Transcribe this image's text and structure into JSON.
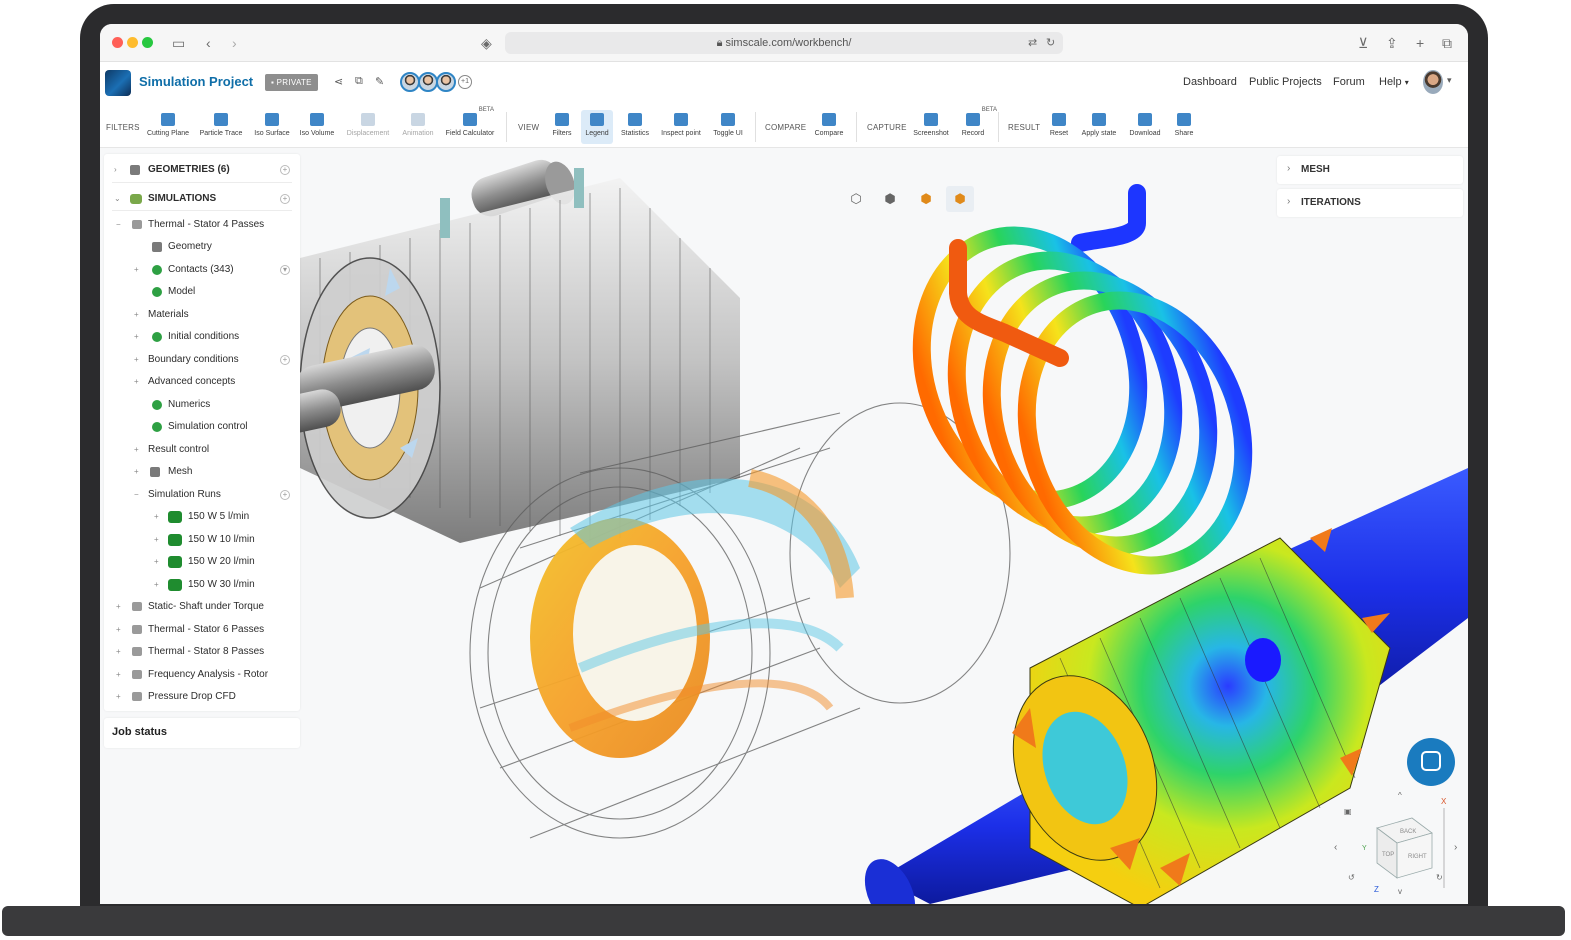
{
  "browser": {
    "url": "simscale.com/workbench/"
  },
  "header": {
    "project_title": "Simulation Project",
    "private_label": "PRIVATE",
    "more_collaborators": "+1",
    "nav": [
      "Dashboard",
      "Public Projects",
      "Forum",
      "Help"
    ]
  },
  "toolbar": {
    "groups": {
      "filters": "FILTERS",
      "view": "VIEW",
      "compare": "COMPARE",
      "capture": "CAPTURE",
      "result": "RESULT"
    },
    "beta": "BETA",
    "buttons": {
      "cutting_plane": "Cutting Plane",
      "particle_trace": "Particle Trace",
      "iso_surface": "Iso Surface",
      "iso_volume": "Iso Volume",
      "displacement": "Displacement",
      "animation": "Animation",
      "field_calculator": "Field Calculator",
      "filters": "Filters",
      "legend": "Legend",
      "statistics": "Statistics",
      "inspect_point": "Inspect point",
      "toggle_ui": "Toggle UI",
      "compare": "Compare",
      "screenshot": "Screenshot",
      "record": "Record",
      "reset": "Reset",
      "apply_state": "Apply state",
      "download": "Download",
      "share": "Share"
    }
  },
  "tree": {
    "geometries": "GEOMETRIES (6)",
    "simulations": "SIMULATIONS",
    "items": [
      "Thermal - Stator 4 Passes",
      "Geometry",
      "Contacts (343)",
      "Model",
      "Materials",
      "Initial conditions",
      "Boundary conditions",
      "Advanced concepts",
      "Numerics",
      "Simulation control",
      "Result control",
      "Mesh",
      "Simulation Runs",
      "150 W 5 l/min",
      "150 W 10 l/min",
      "150 W 20 l/min",
      "150 W 30 l/min",
      "Static- Shaft under Torque",
      "Thermal - Stator 6 Passes",
      "Thermal - Stator 8 Passes",
      "Frequency Analysis - Rotor",
      "Pressure Drop CFD"
    ],
    "job_status": "Job status"
  },
  "right_panels": {
    "mesh": "MESH",
    "iterations": "ITERATIONS"
  },
  "nav_cube": {
    "back": "BACK",
    "top": "TOP",
    "right": "RIGHT",
    "axis_x": "X",
    "axis_y": "Y",
    "axis_z": "Z"
  },
  "colors": {
    "brand": "#0f6ea8",
    "accent": "#3f86c7",
    "ok": "#2ea043"
  }
}
